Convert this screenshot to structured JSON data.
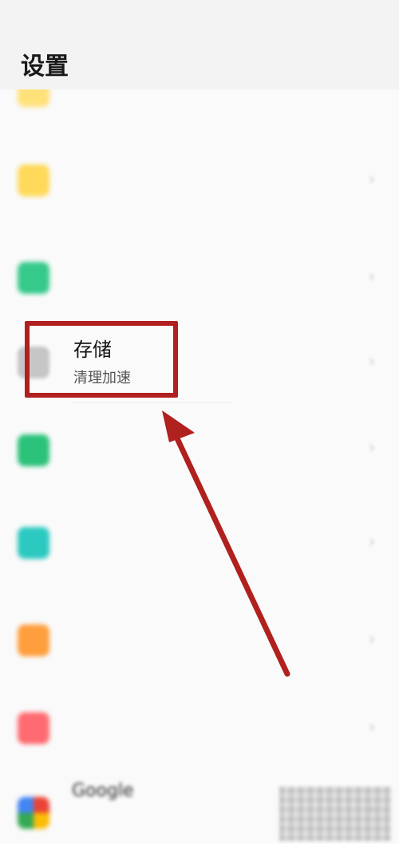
{
  "status_bar": {
    "time": "",
    "icons_text": ""
  },
  "header": {
    "title": "设置"
  },
  "list": {
    "items": [
      {
        "title": "",
        "subtitle": "",
        "icon_color": "#ffe17a",
        "icon": "notification-icon",
        "has_chevron": false
      },
      {
        "title": "",
        "subtitle": "",
        "icon_color": "#ffd95a",
        "icon": "app-icon",
        "has_chevron": true
      },
      {
        "title": "",
        "subtitle": "",
        "icon_color": "#35c98a",
        "icon": "battery-icon",
        "has_chevron": true
      },
      {
        "title": "存储",
        "subtitle": "清理加速",
        "icon_color": "#c6c6c6",
        "icon": "storage-icon",
        "has_chevron": true
      },
      {
        "title": "",
        "subtitle": "",
        "icon_color": "#2bc27a",
        "icon": "device-icon",
        "has_chevron": true
      },
      {
        "title": "",
        "subtitle": "",
        "icon_color": "#2cc9c1",
        "icon": "security-icon",
        "has_chevron": true
      },
      {
        "title": "",
        "subtitle": "",
        "icon_color": "#ff9e3d",
        "icon": "assist-icon",
        "has_chevron": true
      },
      {
        "title": "",
        "subtitle": "",
        "icon_color": "#ff6b70",
        "icon": "account-icon",
        "has_chevron": true
      },
      {
        "title": "Google",
        "subtitle": "",
        "icon_color": "#4285f4",
        "icon": "google-icon",
        "has_chevron": true
      }
    ]
  },
  "annotation": {
    "box_color": "#b0201e",
    "arrow_color": "#b0201e"
  }
}
